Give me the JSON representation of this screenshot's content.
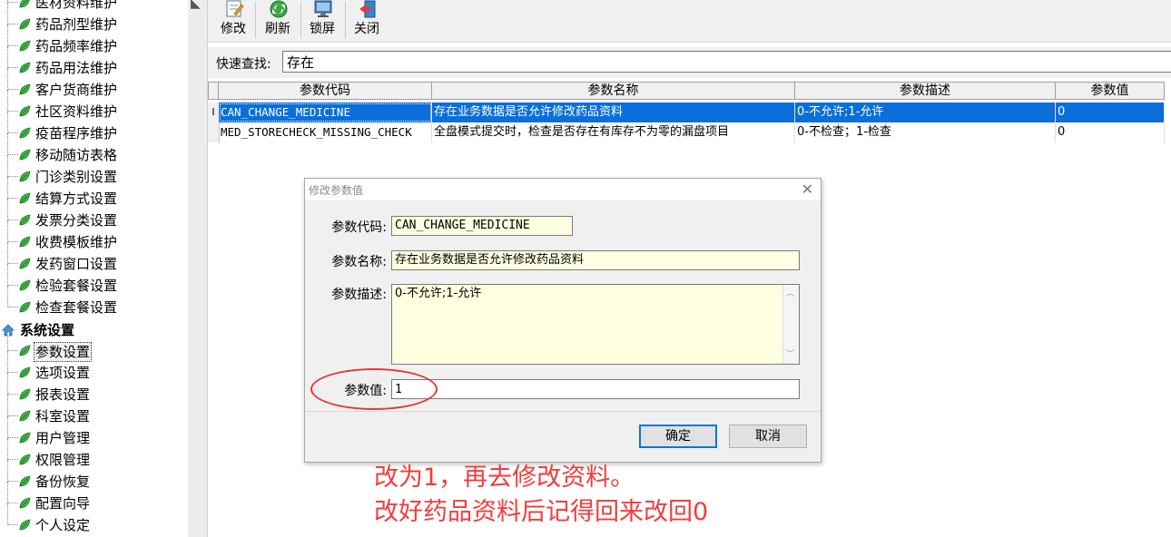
{
  "sidebar": {
    "items_top": [
      "医材资料维护",
      "药品剂型维护",
      "药品频率维护",
      "药品用法维护",
      "客户货商维护",
      "社区资料维护",
      "疫苗程序维护",
      "移动随访表格",
      "门诊类别设置",
      "结算方式设置",
      "发票分类设置",
      "收费模板维护",
      "发药窗口设置",
      "检验套餐设置",
      "检查套餐设置"
    ],
    "group": "系统设置",
    "items_bottom": [
      "参数设置",
      "选项设置",
      "报表设置",
      "科室设置",
      "用户管理",
      "权限管理",
      "备份恢复",
      "配置向导",
      "个人设定"
    ]
  },
  "toolbar": {
    "edit": "修改",
    "refresh": "刷新",
    "lock": "锁屏",
    "close": "关闭"
  },
  "quick_search": {
    "label": "快速查找:",
    "value": "存在"
  },
  "grid": {
    "headers": [
      "参数代码",
      "参数名称",
      "参数描述",
      "参数值"
    ],
    "rows": [
      {
        "indicator": "I",
        "code": "CAN_CHANGE_MEDICINE",
        "name": "存在业务数据是否允许修改药品资料",
        "desc": "0-不允许;1-允许",
        "value": "0"
      },
      {
        "indicator": "",
        "code": "MED_STORECHECK_MISSING_CHECK",
        "name": "全盘模式提交时，检查是否存在有库存不为零的漏盘项目",
        "desc": "0-不检查；1-检查",
        "value": "0"
      }
    ]
  },
  "dialog": {
    "title": "修改参数值",
    "code_label": "参数代码:",
    "code_value": "CAN_CHANGE_MEDICINE",
    "name_label": "参数名称:",
    "name_value": "存在业务数据是否允许修改药品资料",
    "desc_label": "参数描述:",
    "desc_value": "0-不允许;1-允许",
    "value_label": "参数值:",
    "value_value": "1",
    "ok": "确定",
    "cancel": "取消"
  },
  "annotation": {
    "line1": "改为1，再去修改资料。",
    "line2": "改好药品资料后记得回来改回0",
    "color": "#f23c3c"
  }
}
